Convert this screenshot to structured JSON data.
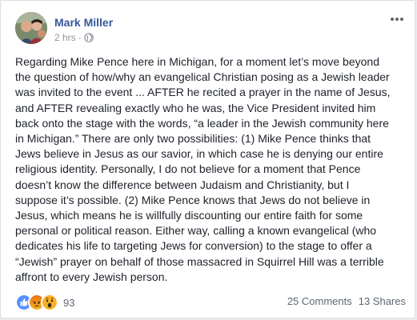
{
  "post": {
    "author": "Mark Miller",
    "time": "2 hrs",
    "separator": "·",
    "text": "Regarding Mike Pence here in Michigan, for a moment let’s move beyond\nthe question of how/why an evangelical Christian posing as a Jewish leader\nwas invited to the event ... AFTER he recited a prayer in the name of Jesus,\nand AFTER revealing exactly who he was, the Vice President invited him\nback onto the stage with the words, “a leader in the Jewish community here\nin Michigan.” There are only two possibilities: (1) Mike Pence thinks that\nJews believe in Jesus as our savior, in which case he is denying our entire\nreligious identity. Personally, I do not believe for a moment that Pence\ndoesn’t know the difference between Judaism and Christianity, but I\nsuppose it’s possible. (2) Mike Pence knows that Jews do not believe in\nJesus, which means he is willfully discounting our entire faith for some\npersonal or political reason. Either way, calling a known evangelical (who\ndedicates his life to targeting Jews for conversion) to the stage to offer a\n“Jewish” prayer on behalf of those massacred in Squirrel Hill was a terrible\naffront to every Jewish person."
  },
  "footer": {
    "reaction_count": "93",
    "comments": "25 Comments",
    "shares": "13 Shares"
  },
  "icons": {
    "privacy": "globe-icon",
    "menu": "more-icon",
    "reactions": [
      "like-icon",
      "angry-icon",
      "wow-icon"
    ]
  },
  "colors": {
    "author_link": "#365899",
    "body_text": "#1d2129",
    "meta_text": "#90949c",
    "like_blue": "#5890ff",
    "angry_red": "#e9710f",
    "wow_yellow": "#f7b125"
  }
}
